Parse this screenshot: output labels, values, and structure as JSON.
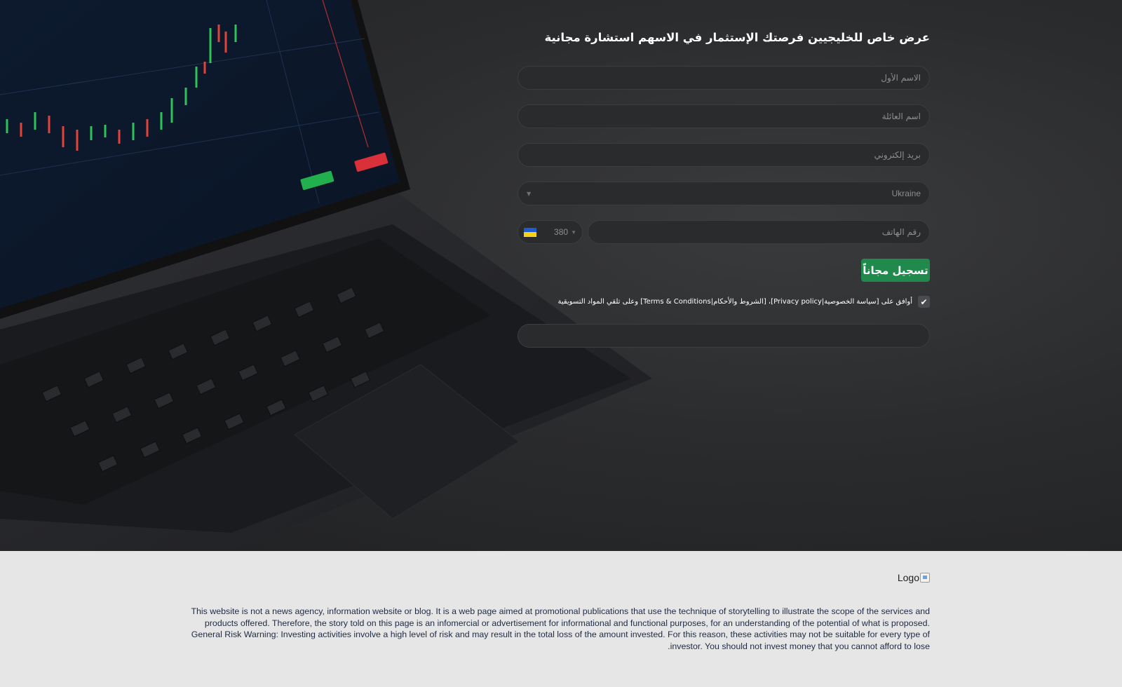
{
  "hero": {
    "title": "عرض خاص للخليجيين فرصتك الإستثمار في الاسهم استشارة مجانية"
  },
  "form": {
    "first_name_placeholder": "الاسم الأول",
    "last_name_placeholder": "اسم العائلة",
    "email_placeholder": "بريد إلكتروني",
    "country_value": "Ukraine",
    "phone_placeholder": "رقم الهاتف",
    "phone_code": "380",
    "submit_label": "تسجيل مجاناً",
    "consent_text": "أوافق على [سياسة الخصوصية|Privacy policy]، [الشروط والأحكام|Terms & Conditions] وعلى تلقي المواد التسويقية",
    "consent_checked": true
  },
  "footer": {
    "logo_alt": "Logo",
    "disclaimer": "This website is not a news agency, information website or blog. It is a web page aimed at promotional publications that use the technique of storytelling to illustrate the scope of the services and products offered. Therefore, the story told on this page is an infomercial or advertisement for informational and functional purposes, for an understanding of the potential of what is proposed. General Risk Warning: Investing activities involve a high level of risk and may result in the total loss of the amount invested. For this reason, these activities may not be suitable for every type of investor. You should not invest money that you cannot afford to lose."
  },
  "colors": {
    "hero_bg": "#2b2c2e",
    "field_bg": "#2a2b2d",
    "submit_bg": "#1f8a4c",
    "footer_bg": "#e6e6e6",
    "disclaimer_text": "#1f2a44"
  },
  "icons": {
    "flag": "ukraine-flag-icon",
    "caret": "chevron-down-icon",
    "check": "check-icon",
    "logo": "broken-image-icon"
  }
}
